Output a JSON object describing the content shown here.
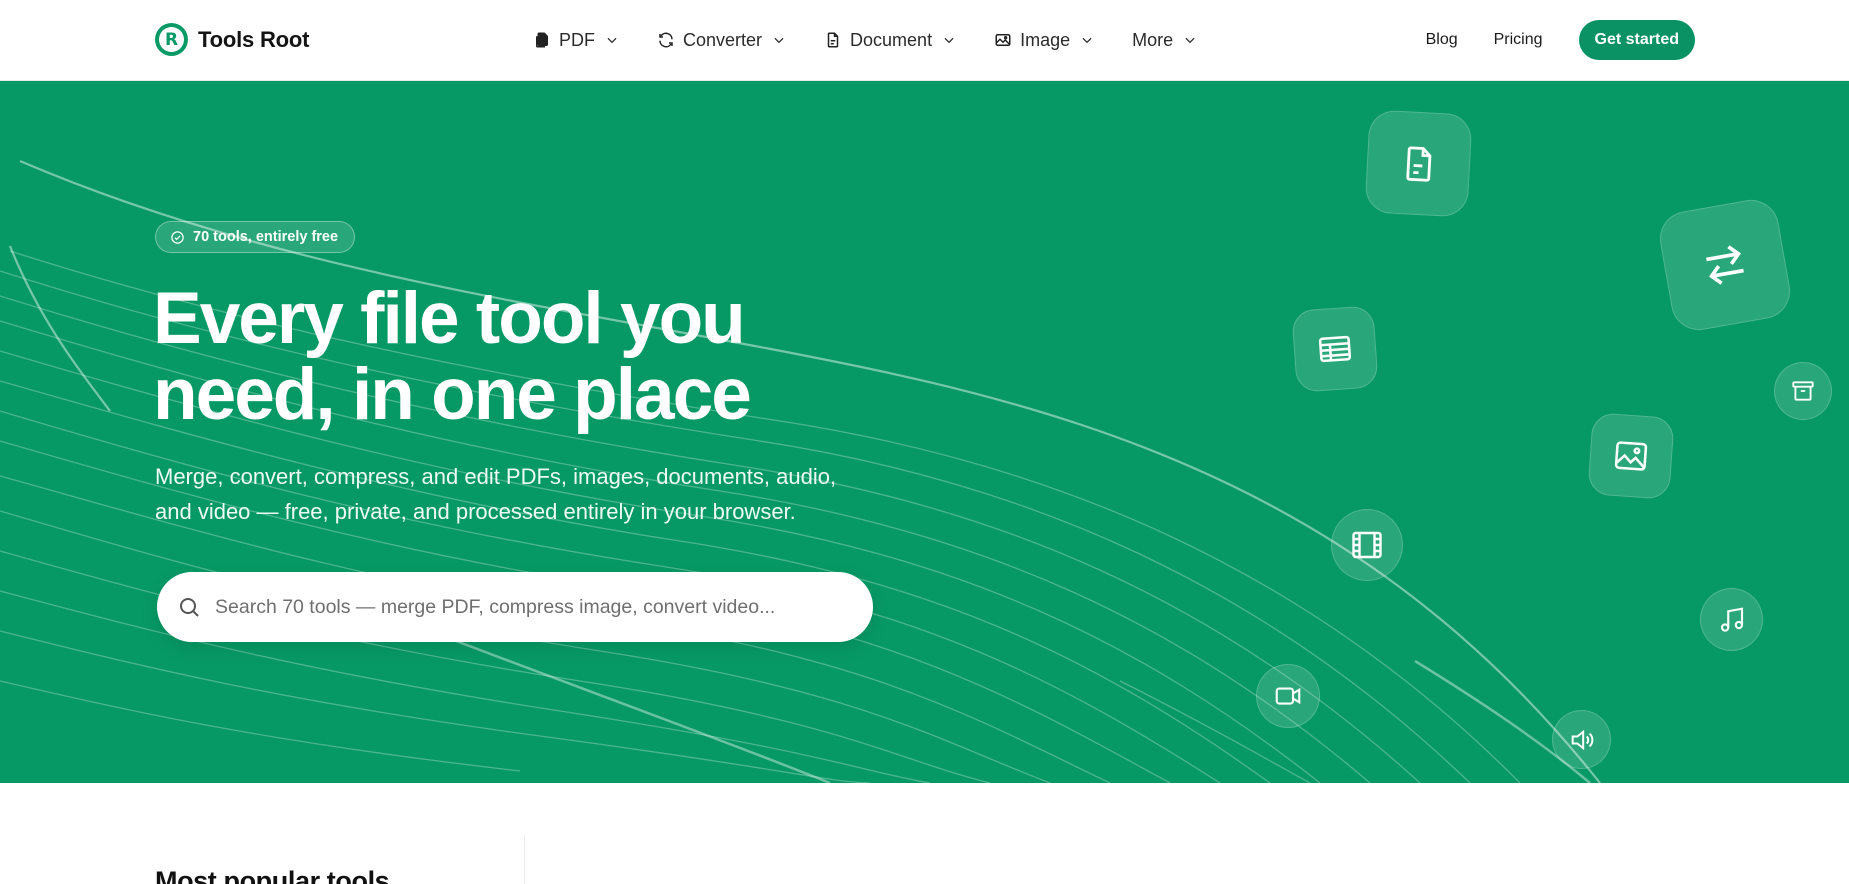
{
  "brand": {
    "name": "Tools Root",
    "logo_letter": "R",
    "accent": "#0a9265",
    "hero_bg": "#079965"
  },
  "nav": {
    "menu": [
      {
        "label": "PDF",
        "icon": "pdf-files-icon"
      },
      {
        "label": "Converter",
        "icon": "refresh-icon"
      },
      {
        "label": "Document",
        "icon": "document-icon"
      },
      {
        "label": "Image",
        "icon": "image-icon"
      },
      {
        "label": "More",
        "icon": ""
      }
    ],
    "blog": "Blog",
    "pricing": "Pricing",
    "cta": "Get started"
  },
  "hero": {
    "badge": "70 tools, entirely free",
    "title_line1": "Every file tool you",
    "title_line2": "need, in one place",
    "subtitle_line1": "Merge, convert, compress, and edit PDFs, images, documents, audio,",
    "subtitle_line2": "and video — free, private, and processed entirely in your browser.",
    "search_placeholder": "Search 70 tools — merge PDF, compress image, convert video...",
    "floating_icons": [
      "document-icon",
      "swap-arrows-icon",
      "spreadsheet-icon",
      "archive-icon",
      "image-icon",
      "film-icon",
      "music-icon",
      "video-camera-icon",
      "speaker-icon"
    ]
  },
  "popular": {
    "title": "Most popular tools"
  }
}
